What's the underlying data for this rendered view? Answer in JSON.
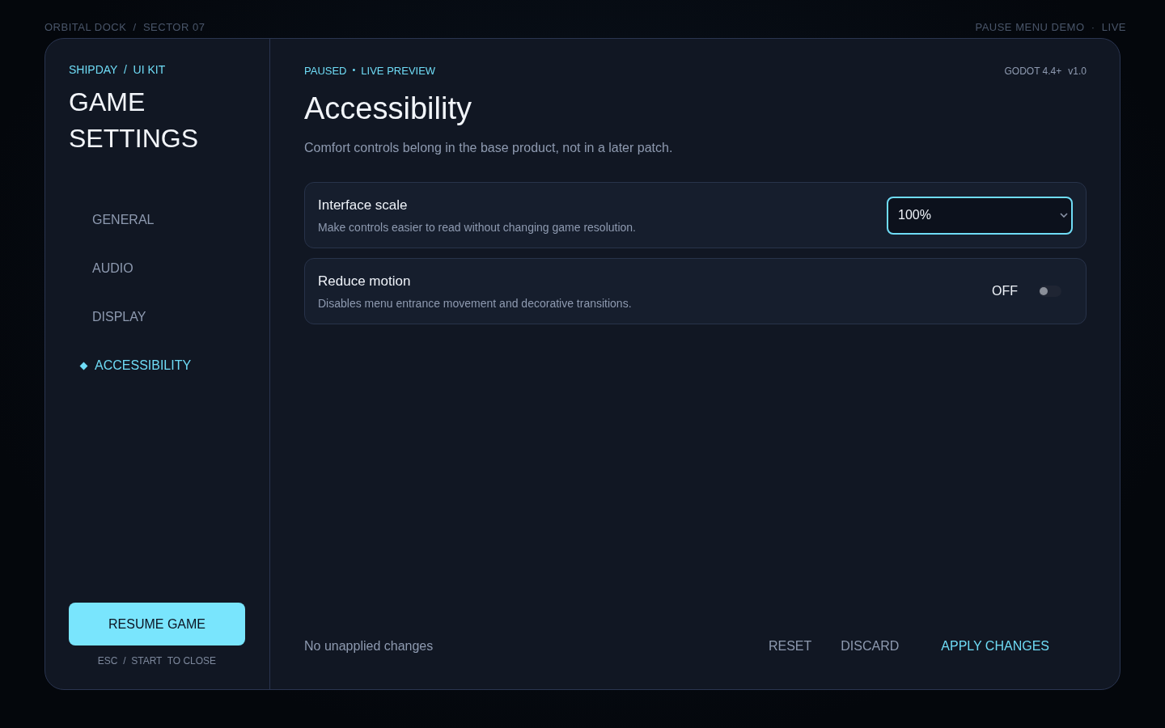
{
  "backdrop": {
    "left_label": "ORBITAL DOCK  /  SECTOR 07",
    "right_label": "PAUSE MENU DEMO  ·  LIVE"
  },
  "sidebar": {
    "breadcrumb": "SHIPDAY  /  UI KIT",
    "title": "GAME SETTINGS",
    "items": [
      {
        "label": "GENERAL",
        "selected": false
      },
      {
        "label": "AUDIO",
        "selected": false
      },
      {
        "label": "DISPLAY",
        "selected": false
      },
      {
        "label": "ACCESSIBILITY",
        "selected": true
      }
    ],
    "resume_button": "RESUME GAME",
    "hint": "ESC  /  START  TO CLOSE"
  },
  "header": {
    "status": "PAUSED",
    "separator": "•",
    "mode": "LIVE PREVIEW",
    "engine": "GODOT 4.4+",
    "version": "v1.0"
  },
  "page": {
    "title": "Accessibility",
    "subtitle": "Comfort controls belong in the base product, not in a later patch."
  },
  "settings": [
    {
      "kind": "select",
      "label": "Interface scale",
      "description": "Make controls easier to read without changing game resolution.",
      "value": "100%",
      "focused": true
    },
    {
      "kind": "toggle",
      "label": "Reduce motion",
      "description": "Disables menu entrance movement and decorative transitions.",
      "state_label": "OFF",
      "on": false
    }
  ],
  "footer": {
    "status": "No unapplied changes",
    "buttons": [
      {
        "label": "RESET",
        "kind": "plain"
      },
      {
        "label": "DISCARD",
        "kind": "plain"
      },
      {
        "label": "APPLY CHANGES",
        "kind": "primary"
      }
    ]
  }
}
